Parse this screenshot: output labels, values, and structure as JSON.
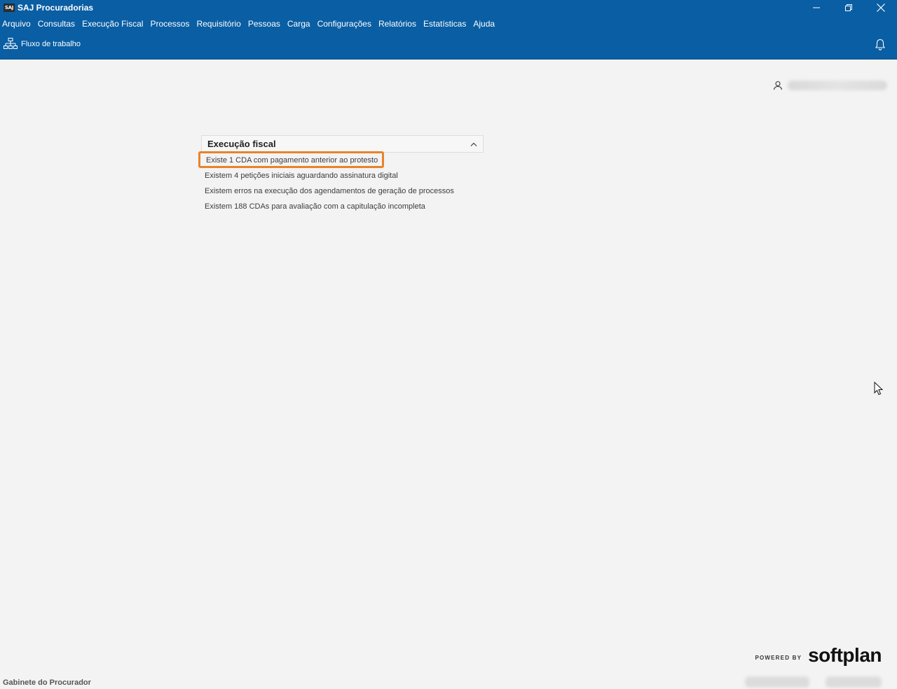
{
  "window": {
    "app_logo_text": "SAJ",
    "title": "SAJ Procuradorias"
  },
  "menu": [
    "Arquivo",
    "Consultas",
    "Execução Fiscal",
    "Processos",
    "Requisitório",
    "Pessoas",
    "Carga",
    "Configurações",
    "Relatórios",
    "Estatísticas",
    "Ajuda"
  ],
  "toolbar": {
    "workflow_label": "Fluxo de trabalho",
    "workflow_icon": "sitemap-icon",
    "notifications_icon": "bell-icon"
  },
  "user": {
    "icon": "user-icon"
  },
  "panel": {
    "title": "Execução fiscal",
    "notices": [
      "Existe 1 CDA com pagamento anterior ao protesto",
      "Existem  4 petições iniciais aguardando assinatura digital",
      "Existem erros na execução dos agendamentos de geração de processos",
      "Existem  188 CDAs para avaliação com a capitulação incompleta"
    ],
    "highlight_color": "#e8832a"
  },
  "footer": {
    "powered_by": "POWERED BY",
    "brand": "softplan",
    "status_text": "Gabinete do Procurador"
  },
  "colors": {
    "primary": "#0a5ea3",
    "background": "#f3f3f3"
  }
}
